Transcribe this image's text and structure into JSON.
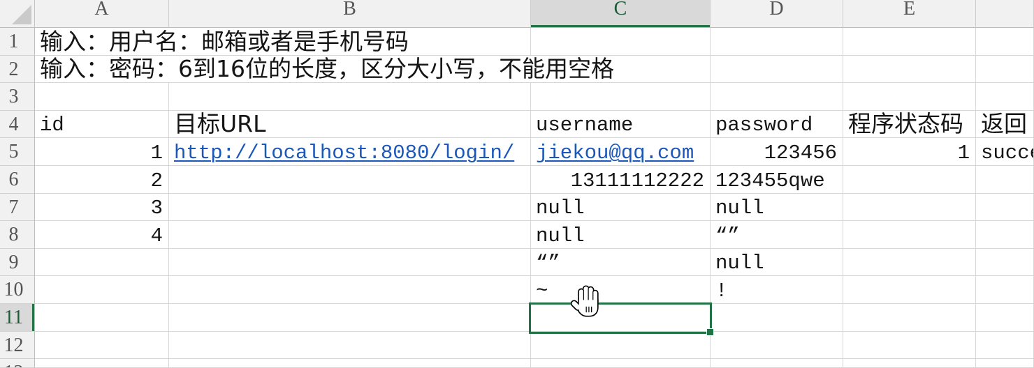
{
  "sheet": {
    "columns": [
      "A",
      "B",
      "C",
      "D",
      "E",
      null
    ],
    "rows": [
      {
        "label": 1,
        "cells": [
          "输入：用户名：邮箱或者是手机号码",
          null,
          null,
          null,
          null,
          null
        ]
      },
      {
        "label": 2,
        "cells": [
          "输入：密码：6到16位的长度，区分大小写，不能用空格",
          null,
          null,
          null,
          null,
          null
        ]
      },
      {
        "label": 3,
        "cells": [
          null,
          null,
          null,
          null,
          null,
          null
        ]
      },
      {
        "label": 4,
        "cells": [
          "id",
          "目标URL",
          "username",
          "password",
          "程序状态码",
          "返回"
        ]
      },
      {
        "label": 5,
        "cells": [
          1,
          {
            "text": "http://localhost:8080/login/",
            "hyperlink": true
          },
          {
            "text": "jiekou@qq.com",
            "hyperlink": true
          },
          123456,
          1,
          "succe"
        ]
      },
      {
        "label": 6,
        "cells": [
          2,
          null,
          13111112222,
          "123455qwe",
          null,
          null
        ]
      },
      {
        "label": 7,
        "cells": [
          3,
          null,
          "null",
          "null",
          null,
          null
        ]
      },
      {
        "label": 8,
        "cells": [
          4,
          null,
          "null",
          "“”",
          null,
          null
        ]
      },
      {
        "label": 9,
        "cells": [
          null,
          null,
          "“”",
          "null",
          null,
          null
        ]
      },
      {
        "label": 10,
        "cells": [
          null,
          null,
          "~",
          "!",
          null,
          null
        ]
      },
      {
        "label": 11,
        "cells": [
          null,
          null,
          null,
          null,
          null,
          null
        ]
      },
      {
        "label": 12,
        "cells": [
          null,
          null,
          null,
          null,
          null,
          null
        ]
      },
      {
        "label": 13,
        "cells": [
          null,
          null,
          null,
          null,
          null,
          null
        ]
      }
    ],
    "selection": {
      "column_index": 2,
      "row_index": 10
    }
  },
  "icons": {
    "select_all": "select-all-triangle-icon",
    "cursor": "hand-cursor-icon"
  },
  "colors": {
    "accent": "#217346",
    "accent_text": "#1c5a38",
    "link": "#1a57b9",
    "text": "#151515",
    "grid": "#d6d6d6",
    "header_bg": "#f1f1f1",
    "header_selected_bg": "#d9d9d9",
    "header_text": "#555555"
  }
}
